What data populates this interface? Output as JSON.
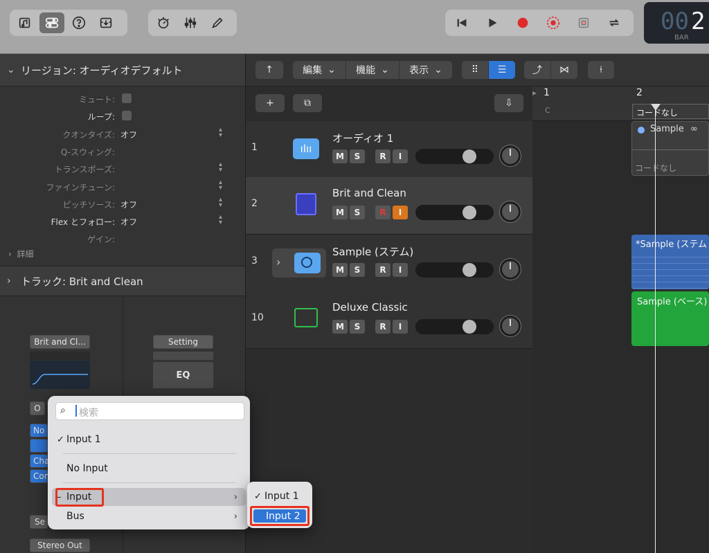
{
  "lcd": {
    "digits_dim": "00",
    "digit_bright": "2",
    "label": "BAR"
  },
  "inspector": {
    "region_header": "リージョン: オーディオデフォルト",
    "params": [
      {
        "key": "ミュート:",
        "value": ""
      },
      {
        "key": "ループ:",
        "value": ""
      },
      {
        "key": "クオンタイズ:",
        "value": "オフ"
      },
      {
        "key": "Q-スウィング:",
        "value": ""
      },
      {
        "key": "トランスポーズ:",
        "value": ""
      },
      {
        "key": "ファインチューン:",
        "value": ""
      },
      {
        "key": "ピッチソース:",
        "value": "オフ"
      },
      {
        "key": "Flex とフォロー:",
        "value": "オフ"
      },
      {
        "key": "ゲイン:",
        "value": ""
      }
    ],
    "detail_label": "詳細",
    "track_header": "トラック:  Brit and Clean",
    "channel_buttons": {
      "plugin": "Brit and Cl...",
      "setting": "Setting",
      "eq": "EQ",
      "o": "O",
      "no": "No",
      "cha": "Cha",
      "con": "Con",
      "se": "Se",
      "stereo_out": "Stereo Out"
    }
  },
  "toolbar": {
    "edit": "編集",
    "function": "機能",
    "view": "表示"
  },
  "tracks": [
    {
      "num": "1",
      "name": "オーディオ 1",
      "m": "M",
      "s": "S",
      "r": "R",
      "i": "I"
    },
    {
      "num": "2",
      "name": "Brit and Clean",
      "m": "M",
      "s": "S",
      "r": "R",
      "i": "I"
    },
    {
      "num": "3",
      "name": "Sample (ステム)",
      "m": "M",
      "s": "S",
      "r": "R",
      "i": "I"
    },
    {
      "num": "10",
      "name": "Deluxe Classic",
      "m": "M",
      "s": "S",
      "r": "R",
      "i": "I"
    }
  ],
  "timeline": {
    "bar1": "1",
    "bar2": "2",
    "chord_c": "C",
    "chord_none_top": "コードなし",
    "sample_region": "Sample",
    "chord_none_region": "コードなし",
    "stem_region": "*Sample (ステム",
    "bass_region": "Sample (ベース)"
  },
  "popup": {
    "search_placeholder": "検索",
    "items": [
      {
        "label": "Input 1",
        "check": "✓"
      },
      {
        "label": "No Input",
        "check": ""
      },
      {
        "label": "Input",
        "check": "–"
      },
      {
        "label": "Bus",
        "check": ""
      }
    ],
    "submenu": [
      {
        "label": "Input 1",
        "check": "✓"
      },
      {
        "label": "Input 2",
        "check": ""
      }
    ]
  },
  "colors": {
    "accent": "#2f76d6",
    "record": "#e02b2b",
    "input_active": "#d9761e",
    "region_blue": "#3b68b3",
    "region_green": "#22a53b"
  }
}
